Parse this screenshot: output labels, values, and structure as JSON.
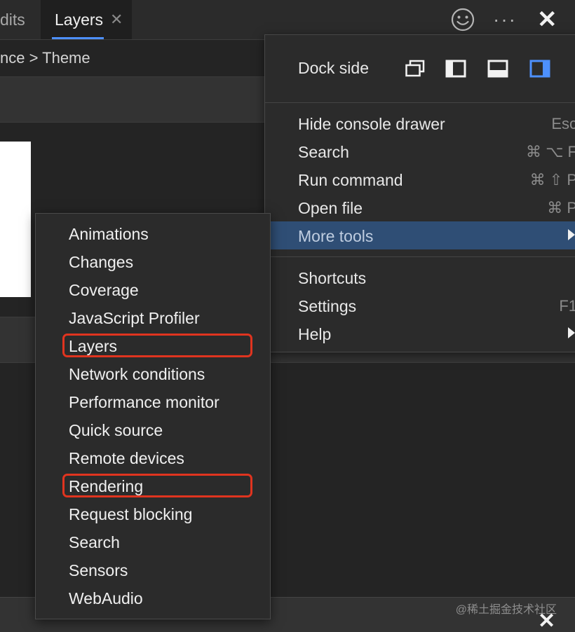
{
  "tabs": {
    "audits_partial": "dits",
    "layers": "Layers",
    "layers_close": "✕"
  },
  "top_right": {
    "more": "···",
    "close": "✕"
  },
  "breadcrumb": {
    "text": "nce > Theme"
  },
  "main_menu": {
    "dock_side": {
      "label": "Dock side",
      "options": [
        "undock-into-separate-window-icon",
        "dock-to-left-icon",
        "dock-to-bottom-icon",
        "dock-to-right-icon"
      ],
      "active_color": "#4d90fe"
    },
    "items": [
      {
        "label": "Hide console drawer",
        "shortcut": "Esc"
      },
      {
        "label": "Search",
        "shortcut": "⌘ ⌥ F"
      },
      {
        "label": "Run command",
        "shortcut": "⌘ ⇧ P"
      },
      {
        "label": "Open file",
        "shortcut": "⌘ P"
      },
      {
        "label": "More tools",
        "shortcut": "",
        "submenu": true,
        "highlighted": true
      },
      {
        "label": "Shortcuts",
        "shortcut": ""
      },
      {
        "label": "Settings",
        "shortcut": "F1"
      },
      {
        "label": "Help",
        "shortcut": "",
        "submenu": true
      }
    ]
  },
  "more_tools_submenu": {
    "items": [
      "Animations",
      "Changes",
      "Coverage",
      "JavaScript Profiler",
      "Layers",
      "Network conditions",
      "Performance monitor",
      "Quick source",
      "Remote devices",
      "Rendering",
      "Request blocking",
      "Search",
      "Sensors",
      "WebAudio"
    ],
    "annotated": [
      "Layers",
      "Rendering"
    ],
    "annotation_color": "#e0341f"
  },
  "bottom": {
    "watermark": "@稀土掘金技术社区",
    "close": "✕"
  },
  "colors": {
    "menu_highlight": "#2f4e75",
    "tab_active_underline": "#4d90fe",
    "background": "#242424"
  }
}
